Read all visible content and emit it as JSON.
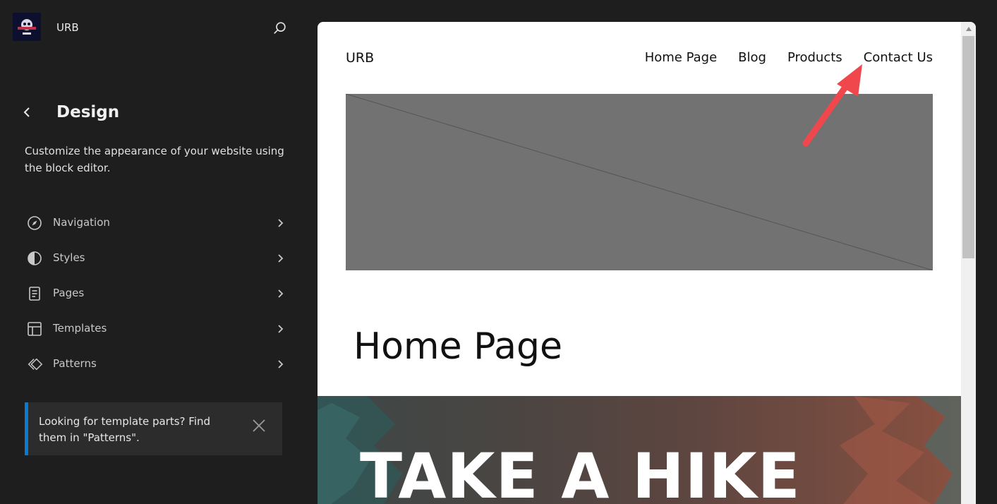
{
  "sidebar": {
    "site_title": "URB",
    "logo_text": "URB",
    "design": {
      "title": "Design",
      "description": "Customize the appearance of your website using the block editor."
    },
    "items": [
      {
        "label": "Navigation",
        "icon": "compass-icon"
      },
      {
        "label": "Styles",
        "icon": "half-circle-icon"
      },
      {
        "label": "Pages",
        "icon": "page-icon"
      },
      {
        "label": "Templates",
        "icon": "layout-icon"
      },
      {
        "label": "Patterns",
        "icon": "diamond-icon"
      }
    ],
    "notice": {
      "text": "Looking for template parts? Find them in \"Patterns\"."
    }
  },
  "preview": {
    "site_title": "URB",
    "nav": [
      "Home Page",
      "Blog",
      "Products",
      "Contact Us"
    ],
    "heading": "Home Page",
    "hero_text": "TAKE A HIKE"
  },
  "colors": {
    "sidebar_bg": "#1e1e1e",
    "notice_accent": "#0a7ad0",
    "annotation_arrow": "#f0474d",
    "image_placeholder": "#727272"
  }
}
